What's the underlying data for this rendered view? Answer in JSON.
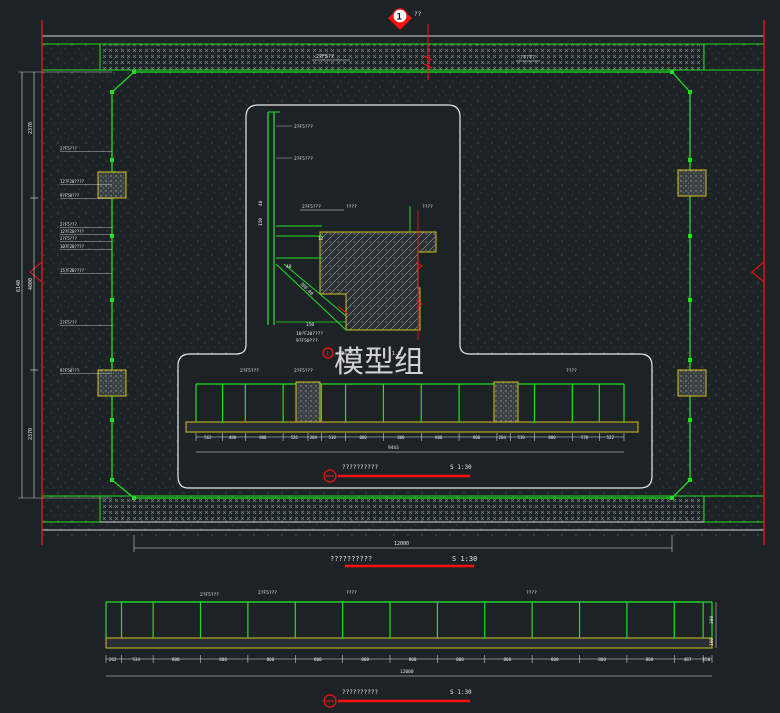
{
  "section_marker": {
    "number": "1",
    "suffix": "??"
  },
  "plan": {
    "top_labels": [
      "2?F5??",
      "?????"
    ],
    "left_dims": [
      "2370",
      "4800",
      "2370"
    ],
    "left_total": "6140",
    "left_labels": [
      "2?F5???",
      "12?F20????",
      "9?F50???",
      "2?F5???",
      "12?F20????",
      "2?F5???",
      "10?F20????",
      "15?F20????",
      "2?F5???",
      "9?F50???"
    ],
    "bottom_dim": "12000",
    "title": "??????????",
    "scale": "S 1:30"
  },
  "detail": {
    "labels": [
      "2?F5???",
      "2?F5???",
      "2?F5???",
      "????",
      "????",
      "10?F20????",
      "9?F50???"
    ],
    "dims_vertical": [
      "150",
      "40"
    ],
    "dims_small": [
      "150",
      "12",
      "40"
    ],
    "dim_diag": "300.00",
    "mark": "1",
    "note": "?????",
    "mark_text": "1.0"
  },
  "inner_elev": {
    "labels": [
      "2?F5???",
      "2?F5???",
      "????"
    ],
    "dims": [
      "562",
      "480",
      "800",
      "526",
      "284",
      "510",
      "800",
      "800",
      "800",
      "800",
      "284",
      "510",
      "800",
      "570",
      "522"
    ],
    "total": "9443",
    "title": "??????????",
    "scale": "S 1:30"
  },
  "elevation": {
    "labels": [
      "2?F5???",
      "2?F5???",
      "????",
      "????"
    ],
    "dims": [
      "262",
      "534",
      "800",
      "800",
      "800",
      "800",
      "800",
      "800",
      "800",
      "800",
      "800",
      "800",
      "800",
      "487",
      "150"
    ],
    "total": "12000",
    "right_dims": [
      "300",
      "100"
    ],
    "title": "??????????",
    "scale": "S 1:30"
  },
  "watermark": "模型组",
  "colors": {
    "background": "#1c2226",
    "green": "#21e020",
    "white": "#e8e8e8",
    "red": "#ff1010",
    "yellow": "#d4c01a"
  }
}
